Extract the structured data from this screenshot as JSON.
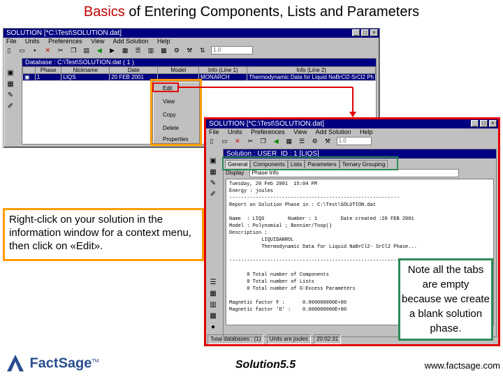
{
  "slide": {
    "title_highlight": "Basics",
    "title_rest": " of Entering Components, Lists and Parameters",
    "footer_center": "Solution5.5",
    "footer_url": "www.factsage.com",
    "logo_text": "FactSage",
    "logo_tm": "TM"
  },
  "main_window": {
    "title": "SOLUTION   [*C:\\Test\\SOLUTION.dat]",
    "menu": [
      "File",
      "Units",
      "Preferences",
      "View",
      "Add Solution",
      "Help"
    ],
    "combo_value": "1.0",
    "database_bar": "Database : C:\\Test\\SOLUTION.dat  ( 1 )",
    "columns": [
      "",
      "Phase",
      "Nickname",
      "Date",
      "Model",
      "Info (Line 1)",
      "Info (Line 2)"
    ],
    "rows": [
      [
        "1",
        "LIQS",
        "20 FEB 2001",
        "",
        "MONARCH",
        "Thermodynamic Data for Liquid NaBrCl2-SrCl2 Ph"
      ]
    ]
  },
  "context_menu": {
    "items": [
      "Edit",
      "View",
      "Copy",
      "Delete",
      "Properties"
    ]
  },
  "edit_window": {
    "title": "SOLUTION   [*C:\\Test\\SOLUTION.dat]",
    "menu": [
      "File",
      "Units",
      "Preferences",
      "View",
      "Add Solution",
      "Help"
    ],
    "combo_value": "1.0",
    "subtitle": "Solution : USER_ID : 1 [LIQS]",
    "tabs": [
      "General",
      "Components",
      "Lists",
      "Parameters",
      "Ternary Grouping"
    ],
    "display_label": "Display",
    "display_value": "Phase Info",
    "log_lines": [
      "Tuesday, 20 Feb 2001  15:04 PM",
      "Energy : joules",
      "----------------------------------------------------------",
      "Report on Solution Phase in : C:\\Test\\SOLUTION.dat",
      "",
      "Name  : LIQS        Number : 1        Date created :20 FEB 2001",
      "Model : Polynomial ; Bonnier/Toop()",
      "Description :",
      "           LIQUIDARROL",
      "           Thermodynamic Data for Liquid NaBrCl2- SrCl2 Phase...",
      "",
      "----------------------------------------------------------",
      "",
      "      0 Total number of Components",
      "      0 Total number of Lists",
      "      0 Total number of G-Excess Parameters",
      "",
      "Magnetic factor F :      0.000000000E+00",
      "Magnetic factor 'D' :    0.000000000E+00"
    ],
    "status": [
      "Total databases : (1)",
      "Units are joules",
      "20:02:31"
    ]
  },
  "callouts": {
    "left": "Right-click on your solution in the information window for a context menu, then click on «Edit».",
    "right": "Note all the tabs are empty because we create a blank solution phase."
  },
  "colors": {
    "title_accent": "#c00000",
    "callout_left_border": "#ff9d00",
    "callout_right_border": "#2e8b57",
    "highlight_box": "#e00000",
    "window_title_bar": "#000080"
  }
}
